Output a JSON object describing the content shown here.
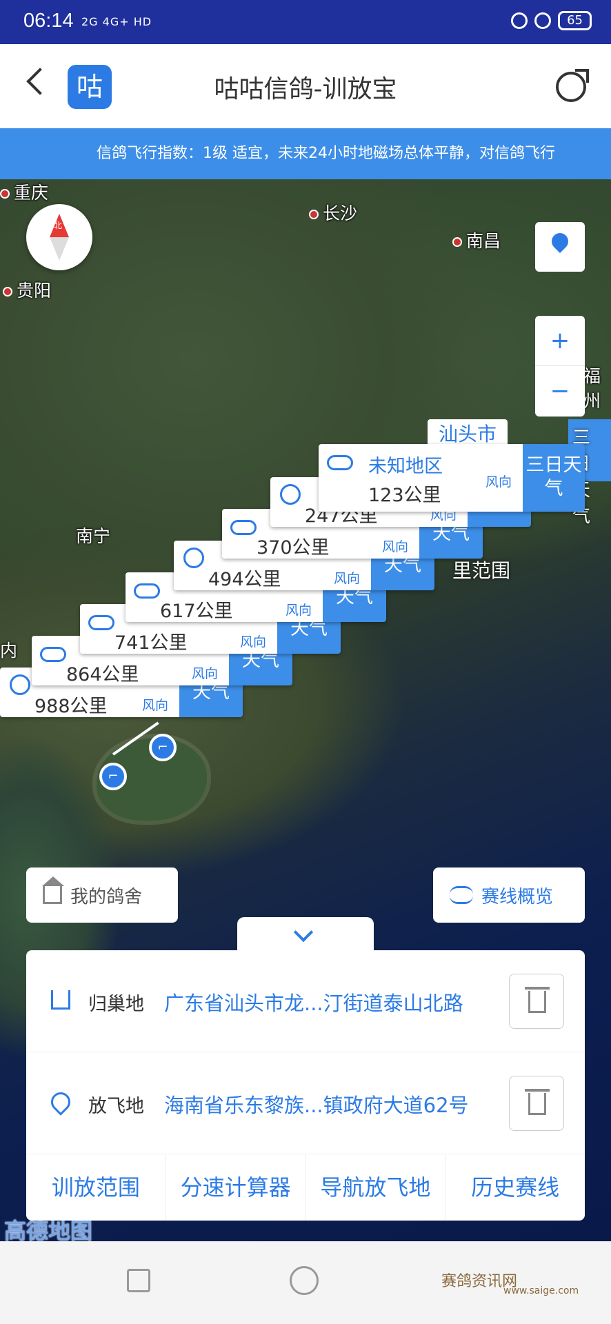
{
  "status": {
    "time": "06:14",
    "signal": "2G 4G+ HD",
    "battery": "65"
  },
  "app": {
    "title": "咕咕信鸽-训放宝",
    "logo": "咕"
  },
  "marquee": "信鸽飞行指数：1级 适宜，未来24小时地磁场总体平静，对信鸽飞行",
  "map": {
    "cities": [
      {
        "name": "重庆"
      },
      {
        "name": "长沙"
      },
      {
        "name": "南昌"
      },
      {
        "name": "贵阳"
      },
      {
        "name": "南宁"
      },
      {
        "name": "福州"
      },
      {
        "name": "内"
      }
    ],
    "compass": "北",
    "zoom_in": "+",
    "zoom_out": "−",
    "shantou_label": "汕头市",
    "three_day_label": "三日天气",
    "range_text": "里范围",
    "cards": [
      {
        "name": "未知地区",
        "distance": "123公里",
        "wind": "风向",
        "weather": "三日天气"
      },
      {
        "distance": "247公里",
        "wind": "风向",
        "weather": "天气",
        "icon": "sun"
      },
      {
        "distance": "370公里",
        "wind": "风向",
        "weather": "天气",
        "icon": "cloud"
      },
      {
        "distance": "494公里",
        "wind": "风向",
        "weather": "天气",
        "icon": "sun"
      },
      {
        "distance": "617公里",
        "wind": "风向",
        "weather": "天气",
        "icon": "cloud"
      },
      {
        "distance": "741公里",
        "wind": "风向",
        "weather": "天气",
        "icon": "cloud"
      },
      {
        "distance": "864公里",
        "wind": "风向",
        "weather": "天气",
        "icon": "cloud"
      },
      {
        "distance": "988公里",
        "wind": "风向",
        "weather": "天气",
        "icon": "sun"
      }
    ],
    "my_loft": "我的鸽舍",
    "route_overview": "赛线概览",
    "attribution": "高德地图"
  },
  "panel": {
    "home": {
      "label": "归巢地",
      "address": "广东省汕头市龙...汀街道泰山北路"
    },
    "release": {
      "label": "放飞地",
      "address": "海南省乐东黎族...镇政府大道62号"
    },
    "tabs": [
      "训放范围",
      "分速计算器",
      "导航放飞地",
      "历史赛线"
    ]
  },
  "watermark": {
    "name": "赛鸽资讯网",
    "url": "www.saige.com"
  }
}
